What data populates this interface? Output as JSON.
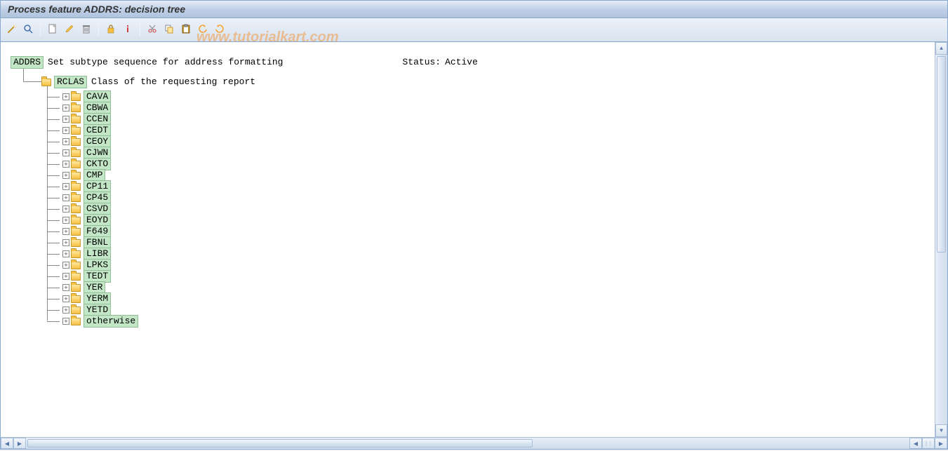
{
  "window": {
    "title": "Process feature ADDRS: decision tree"
  },
  "toolbar": {
    "buttons": [
      "generate-icon",
      "find-icon",
      "create-icon",
      "edit-icon",
      "delete-icon",
      "lock-icon",
      "info-icon",
      "cut-icon",
      "copy-icon",
      "paste-icon",
      "undo-icon",
      "redo-icon"
    ]
  },
  "watermark": "www.tutorialkart.com",
  "tree": {
    "root": {
      "code": "ADDRS",
      "desc": "Set subtype sequence for address formatting",
      "status_label": "Status:",
      "status_value": "Active"
    },
    "child": {
      "code": "RCLAS",
      "desc": "Class of the requesting report"
    },
    "leaves": [
      "CAVA",
      "CBWA",
      "CCEN",
      "CEDT",
      "CEOY",
      "CJWN",
      "CKTO",
      "CMP",
      "CP11",
      "CP45",
      "CSVD",
      "EOYD",
      "F649",
      "FBNL",
      "LIBR",
      "LPKS",
      "TEDT",
      "YER",
      "YERM",
      "YETD",
      "otherwise"
    ]
  }
}
